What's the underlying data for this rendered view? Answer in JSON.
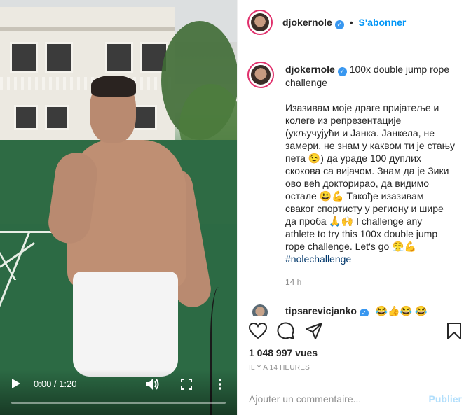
{
  "post": {
    "username": "djokernole",
    "follow_label": "S'abonner",
    "follow_separator": "•"
  },
  "caption": {
    "username": "djokernole",
    "title": "100x double jump rope challenge",
    "line1": "Изазивам моје драге пријатеље и",
    "line2": "колеге из репрезентације",
    "line3": "(укључујући и Јанка. Јанкела, не",
    "line4": "замери, не знам у каквом ти је стању",
    "line5": "пета 😉) да ураде 100 дуплих",
    "line6": "скокова са вијачом. Знам да је Зики",
    "line7": "ово већ докторирао, да видимо",
    "line8": "остале 😃💪 Такође изазивам",
    "line9": "сваког спортисту у региону и шире",
    "line10": "да проба 🙏🙌 I challenge any",
    "line11": "athlete to try this 100x double jump",
    "line12": "rope challenge. Let's go 😤💪",
    "hashtag": "#nolechallenge",
    "time": "14 h"
  },
  "comment_preview": {
    "username": "tipsarevicjanko",
    "text": "😂👍😂 😂"
  },
  "video": {
    "time": "0:00 / 1:20",
    "progress": 0.0
  },
  "stats": {
    "views": "1 048 997 vues",
    "posted_ago": "IL Y A 14 HEURES"
  },
  "comment_box": {
    "placeholder": "Ajouter un commentaire...",
    "publish_label": "Publier"
  },
  "colors": {
    "accent": "#0095f6",
    "verified": "#3897f0",
    "publish_disabled": "#b2dffc",
    "court_green": "#2c6a44"
  },
  "icons": [
    "play-icon",
    "volume-icon",
    "fullscreen-icon",
    "more-vertical-icon",
    "verified-icon",
    "heart-icon",
    "comment-icon",
    "share-icon",
    "bookmark-icon",
    "more-horizontal-icon"
  ]
}
